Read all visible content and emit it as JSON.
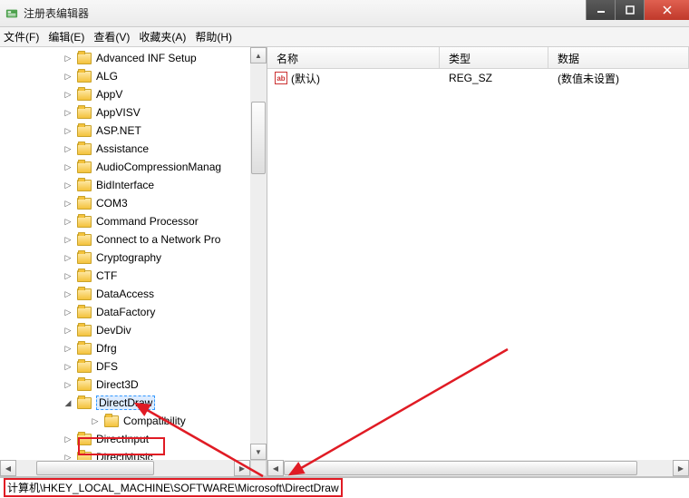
{
  "title": "注册表编辑器",
  "menu": {
    "file": "文件(F)",
    "edit": "编辑(E)",
    "view": "查看(V)",
    "fav": "收藏夹(A)",
    "help": "帮助(H)"
  },
  "tree": {
    "items": [
      "Advanced INF Setup",
      "ALG",
      "AppV",
      "AppVISV",
      "ASP.NET",
      "Assistance",
      "AudioCompressionManag",
      "BidInterface",
      "COM3",
      "Command Processor",
      "Connect to a Network Pro",
      "Cryptography",
      "CTF",
      "DataAccess",
      "DataFactory",
      "DevDiv",
      "Dfrg",
      "DFS",
      "Direct3D"
    ],
    "selected": "DirectDraw",
    "child": "Compatibility",
    "after": [
      "DirectInput",
      "DirectMusic"
    ]
  },
  "columns": {
    "name": "名称",
    "type": "类型",
    "data": "数据"
  },
  "row": {
    "name": "(默认)",
    "icon": "ab",
    "type": "REG_SZ",
    "data": "(数值未设置)"
  },
  "statusbar": "计算机\\HKEY_LOCAL_MACHINE\\SOFTWARE\\Microsoft\\DirectDraw"
}
